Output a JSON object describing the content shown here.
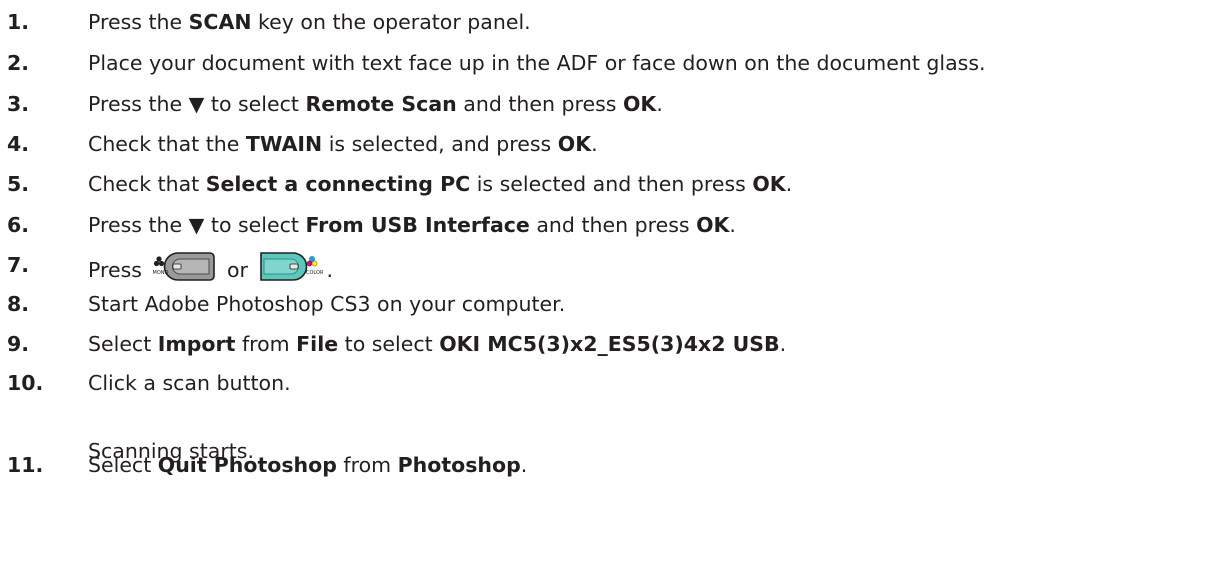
{
  "steps": [
    {
      "num": "1.",
      "parts": [
        {
          "t": "Press the "
        },
        {
          "t": "SCAN",
          "b": true
        },
        {
          "t": " key on the operator panel."
        }
      ]
    },
    {
      "num": "2.",
      "parts": [
        {
          "t": "Place your document with text face up in the ADF or face down on the document glass."
        }
      ]
    },
    {
      "num": "3.",
      "parts": [
        {
          "t": "Press the ▼ to select "
        },
        {
          "t": "Remote Scan",
          "b": true
        },
        {
          "t": " and then press "
        },
        {
          "t": "OK",
          "b": true
        },
        {
          "t": "."
        }
      ]
    },
    {
      "num": "4.",
      "parts": [
        {
          "t": "Check that the "
        },
        {
          "t": "TWAIN",
          "b": true
        },
        {
          "t": " is selected, and press "
        },
        {
          "t": "OK",
          "b": true
        },
        {
          "t": "."
        }
      ]
    },
    {
      "num": "5.",
      "parts": [
        {
          "t": "Check that "
        },
        {
          "t": "Select a connecting PC",
          "b": true
        },
        {
          "t": " is selected and then press "
        },
        {
          "t": "OK",
          "b": true
        },
        {
          "t": "."
        }
      ]
    },
    {
      "num": "6.",
      "parts": [
        {
          "t": "Press the ▼ to select "
        },
        {
          "t": "From USB Interface",
          "b": true
        },
        {
          "t": " and then press "
        },
        {
          "t": "OK",
          "b": true
        },
        {
          "t": "."
        }
      ]
    },
    {
      "num": "7.",
      "parts": [
        {
          "t": "Press "
        },
        {
          "key": "mono"
        },
        {
          "t": " or "
        },
        {
          "key": "color"
        },
        {
          "t": "."
        }
      ]
    },
    {
      "num": "8.",
      "parts": [
        {
          "t": "Start Adobe Photoshop CS3 on your computer."
        }
      ]
    },
    {
      "num": "9.",
      "parts": [
        {
          "t": "Select "
        },
        {
          "t": "Import",
          "b": true
        },
        {
          "t": " from "
        },
        {
          "t": "File",
          "b": true
        },
        {
          "t": " to select "
        },
        {
          "t": "OKI MC5(3)x2_ES5(3)4x2 USB",
          "b": true
        },
        {
          "t": "."
        }
      ]
    },
    {
      "num": "10.",
      "parts": [
        {
          "t": "Click a scan button."
        }
      ]
    },
    {
      "num": "11.",
      "parts": [
        {
          "t": "Select "
        },
        {
          "t": "Quit Photoshop",
          "b": true
        },
        {
          "t": " from "
        },
        {
          "t": "Photoshop",
          "b": true
        },
        {
          "t": "."
        }
      ]
    }
  ],
  "step10_subtext": "Scanning starts.",
  "keys": {
    "mono": {
      "icon": "mono-scan-key-icon",
      "label": "MONO",
      "face_color": "#9a9a9a",
      "accent": "#231f20"
    },
    "color": {
      "icon": "color-scan-key-icon",
      "label": "COLOR",
      "face_color": "#5cc8bd",
      "dot_colors": [
        "#00aeef",
        "#ec008c",
        "#fff200"
      ]
    }
  }
}
